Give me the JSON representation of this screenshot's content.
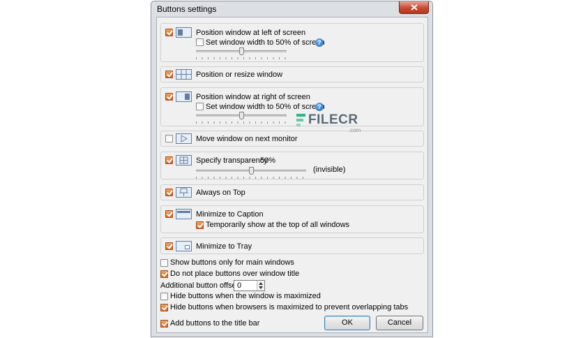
{
  "window": {
    "title": "Buttons settings"
  },
  "groups": [
    {
      "label": "Position window at left of screen",
      "checked": true,
      "icon": "position-left-icon",
      "sub_label": "Set window width to 50% of screen",
      "sub_checked": false,
      "slider_value": 0.5
    },
    {
      "label": "Position or resize window",
      "checked": true,
      "icon": "resize-window-icon"
    },
    {
      "label": "Position window at right of screen",
      "checked": true,
      "icon": "position-right-icon",
      "sub_label": "Set window width to 50% of screen",
      "sub_checked": false,
      "slider_value": 0.5
    },
    {
      "label": "Move window on next monitor",
      "checked": false,
      "icon": "next-monitor-icon"
    },
    {
      "label": "Specify transparency",
      "value": "50%",
      "checked": true,
      "icon": "transparency-icon",
      "slider_value": 0.5,
      "slider_end_label": "(invisible)"
    },
    {
      "label": "Always on Top",
      "checked": true,
      "icon": "pin-icon"
    },
    {
      "label": "Minimize to Caption",
      "checked": true,
      "icon": "minimize-caption-icon",
      "sub_label": "Temporarily show at the top of all windows",
      "sub_checked": true
    },
    {
      "label": "Minimize to Tray",
      "checked": true,
      "icon": "minimize-tray-icon"
    }
  ],
  "options": {
    "show_main_only": {
      "label": "Show buttons only for main windows",
      "checked": false
    },
    "no_place_over_title": {
      "label": "Do not place buttons over window title",
      "checked": true
    },
    "offset": {
      "label": "Additional button offset:",
      "value": "0"
    },
    "hide_maximized": {
      "label": "Hide buttons when the window is maximized",
      "checked": false
    },
    "hide_browsers": {
      "label": "Hide buttons when browsers is maximized to prevent overlapping tabs",
      "checked": true
    },
    "add_title_bar": {
      "label": "Add buttons to the title bar",
      "checked": true
    }
  },
  "buttons": {
    "ok": "OK",
    "cancel": "Cancel"
  },
  "watermark": {
    "text": "FILECR",
    "sub": ".com"
  },
  "help_glyph": "?",
  "colors": {
    "accent_check": "#d4651f",
    "help": "#1a5fc4",
    "watermark": "#2fb38a"
  }
}
